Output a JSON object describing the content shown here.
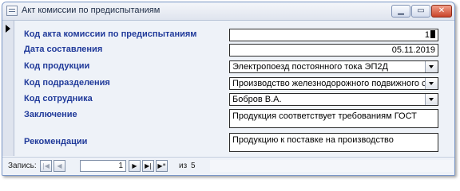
{
  "window": {
    "title": "Акт комиссии по предиспытаниям",
    "min_glyph": "▁",
    "max_glyph": "▭",
    "close_glyph": "✕"
  },
  "fields": {
    "act_code": {
      "label": "Код акта комиссии по предиспытаниям",
      "value": "1"
    },
    "date": {
      "label": "Дата составления",
      "value": "05.11.2019"
    },
    "product": {
      "label": "Код продукции",
      "value": "Электропоезд постоянного тока ЭП2Д"
    },
    "division": {
      "label": "Код подразделения",
      "value": "Производство железнодорожного подвижного с"
    },
    "employee": {
      "label": "Код сотрудника",
      "value": "Бобров В.А."
    },
    "conclusion": {
      "label": "Заключение",
      "value": "Продукция соответствует требованиям ГОСТ"
    },
    "recommendations": {
      "label": "Рекомендации",
      "value": "Продукцию к поставке на производство"
    }
  },
  "navigation": {
    "label": "Запись:",
    "current": "1",
    "of_text": "из",
    "total": "5",
    "first_glyph": "|◀",
    "prev_glyph": "◀",
    "next_glyph": "▶",
    "last_glyph": "▶|",
    "new_glyph": "▶*"
  },
  "icons": {
    "record_selector": "current-record-arrow",
    "combo": "dropdown-arrow"
  }
}
